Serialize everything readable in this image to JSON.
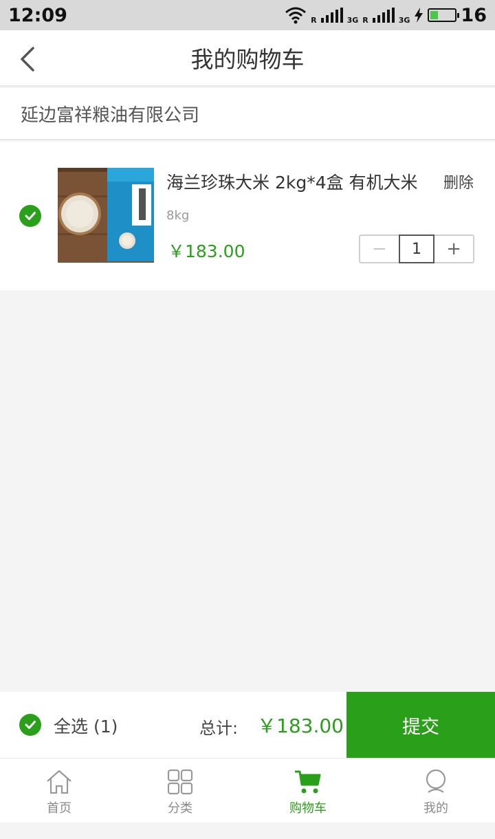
{
  "status_bar": {
    "time": "12:09",
    "roaming_1": "R",
    "network_1": "3G",
    "roaming_2": "R",
    "network_2": "3G",
    "battery_level": "16",
    "battery_fraction": 0.3
  },
  "header": {
    "back_icon": "chevron-left-icon",
    "title": "我的购物车"
  },
  "shop": {
    "name": "延边富祥粮油有限公司"
  },
  "cart_item": {
    "selected": true,
    "title": "海兰珍珠大米 2kg*4盒 有机大米",
    "delete_label": "删除",
    "spec": "8kg",
    "price": "￥183.00",
    "quantity": "1",
    "minus_label": "−",
    "plus_label": "+"
  },
  "footer": {
    "select_all_label": "全选 (1)",
    "total_label": "总计:",
    "total_value": "￥183.00",
    "submit_label": "提交"
  },
  "tabs": [
    {
      "label": "首页",
      "icon": "home-icon",
      "active": false
    },
    {
      "label": "分类",
      "icon": "grid-icon",
      "active": false
    },
    {
      "label": "购物车",
      "icon": "cart-icon",
      "active": true
    },
    {
      "label": "我的",
      "icon": "user-icon",
      "active": false
    }
  ],
  "colors": {
    "accent": "#2aa01a",
    "background": "#f4f4f4"
  }
}
